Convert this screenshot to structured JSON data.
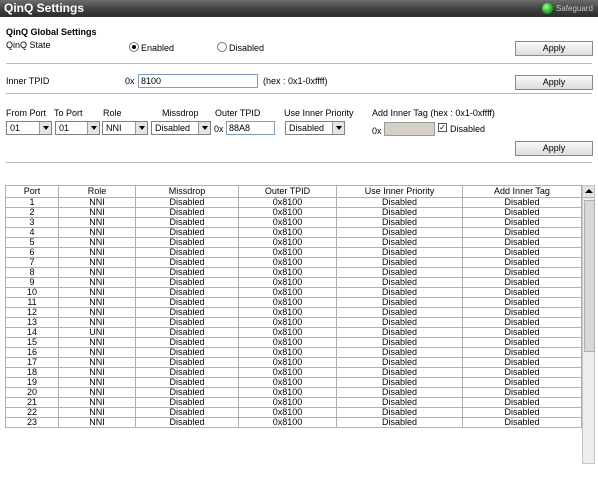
{
  "window": {
    "title": "QinQ Settings",
    "brand": "Safeguard"
  },
  "global": {
    "section_title": "QinQ Global Settings",
    "state_label": "QinQ State",
    "enabled_label": "Enabled",
    "disabled_label": "Disabled",
    "selected": "Enabled",
    "apply": "Apply"
  },
  "tpid": {
    "label": "Inner TPID",
    "prefix": "0x",
    "value": "8100",
    "hint": "(hex : 0x1-0xffff)",
    "apply": "Apply"
  },
  "port_form": {
    "labels": {
      "from_port": "From Port",
      "to_port": "To Port",
      "role": "Role",
      "missdrop": "Missdrop",
      "outer_tpid": "Outer TPID",
      "use_inner_priority": "Use Inner Priority",
      "add_inner_tag": "Add Inner Tag (hex : 0x1-0xffff)"
    },
    "from_port": "01",
    "to_port": "01",
    "role": "NNI",
    "missdrop": "Disabled",
    "outer_prefix": "0x",
    "outer_tpid": "88A8",
    "use_inner_priority": "Disabled",
    "inner_prefix": "0x",
    "inner_tag_value": "",
    "inner_disabled_label": "Disabled",
    "inner_disabled_checked": true,
    "apply": "Apply"
  },
  "table": {
    "headers": [
      "Port",
      "Role",
      "Missdrop",
      "Outer TPID",
      "Use Inner Priority",
      "Add Inner Tag"
    ],
    "rows": [
      [
        "1",
        "NNI",
        "Disabled",
        "0x8100",
        "Disabled",
        "Disabled"
      ],
      [
        "2",
        "NNI",
        "Disabled",
        "0x8100",
        "Disabled",
        "Disabled"
      ],
      [
        "3",
        "NNI",
        "Disabled",
        "0x8100",
        "Disabled",
        "Disabled"
      ],
      [
        "4",
        "NNI",
        "Disabled",
        "0x8100",
        "Disabled",
        "Disabled"
      ],
      [
        "5",
        "NNI",
        "Disabled",
        "0x8100",
        "Disabled",
        "Disabled"
      ],
      [
        "6",
        "NNI",
        "Disabled",
        "0x8100",
        "Disabled",
        "Disabled"
      ],
      [
        "7",
        "NNI",
        "Disabled",
        "0x8100",
        "Disabled",
        "Disabled"
      ],
      [
        "8",
        "NNI",
        "Disabled",
        "0x8100",
        "Disabled",
        "Disabled"
      ],
      [
        "9",
        "NNI",
        "Disabled",
        "0x8100",
        "Disabled",
        "Disabled"
      ],
      [
        "10",
        "NNI",
        "Disabled",
        "0x8100",
        "Disabled",
        "Disabled"
      ],
      [
        "11",
        "NNI",
        "Disabled",
        "0x8100",
        "Disabled",
        "Disabled"
      ],
      [
        "12",
        "NNI",
        "Disabled",
        "0x8100",
        "Disabled",
        "Disabled"
      ],
      [
        "13",
        "NNI",
        "Disabled",
        "0x8100",
        "Disabled",
        "Disabled"
      ],
      [
        "14",
        "UNI",
        "Disabled",
        "0x8100",
        "Disabled",
        "Disabled"
      ],
      [
        "15",
        "NNI",
        "Disabled",
        "0x8100",
        "Disabled",
        "Disabled"
      ],
      [
        "16",
        "NNI",
        "Disabled",
        "0x8100",
        "Disabled",
        "Disabled"
      ],
      [
        "17",
        "NNI",
        "Disabled",
        "0x8100",
        "Disabled",
        "Disabled"
      ],
      [
        "18",
        "NNI",
        "Disabled",
        "0x8100",
        "Disabled",
        "Disabled"
      ],
      [
        "19",
        "NNI",
        "Disabled",
        "0x8100",
        "Disabled",
        "Disabled"
      ],
      [
        "20",
        "NNI",
        "Disabled",
        "0x8100",
        "Disabled",
        "Disabled"
      ],
      [
        "21",
        "NNI",
        "Disabled",
        "0x8100",
        "Disabled",
        "Disabled"
      ],
      [
        "22",
        "NNI",
        "Disabled",
        "0x8100",
        "Disabled",
        "Disabled"
      ],
      [
        "23",
        "NNI",
        "Disabled",
        "0x8100",
        "Disabled",
        "Disabled"
      ]
    ]
  },
  "icons": {
    "status": "status-dot-icon",
    "scroll_up": "scroll-up-arrow-icon",
    "dropdown": "chevron-down-icon"
  },
  "colors": {
    "title_bar": "#3f3f3f",
    "status_dot": "#1ea81e",
    "input_border": "#7f9db9"
  }
}
